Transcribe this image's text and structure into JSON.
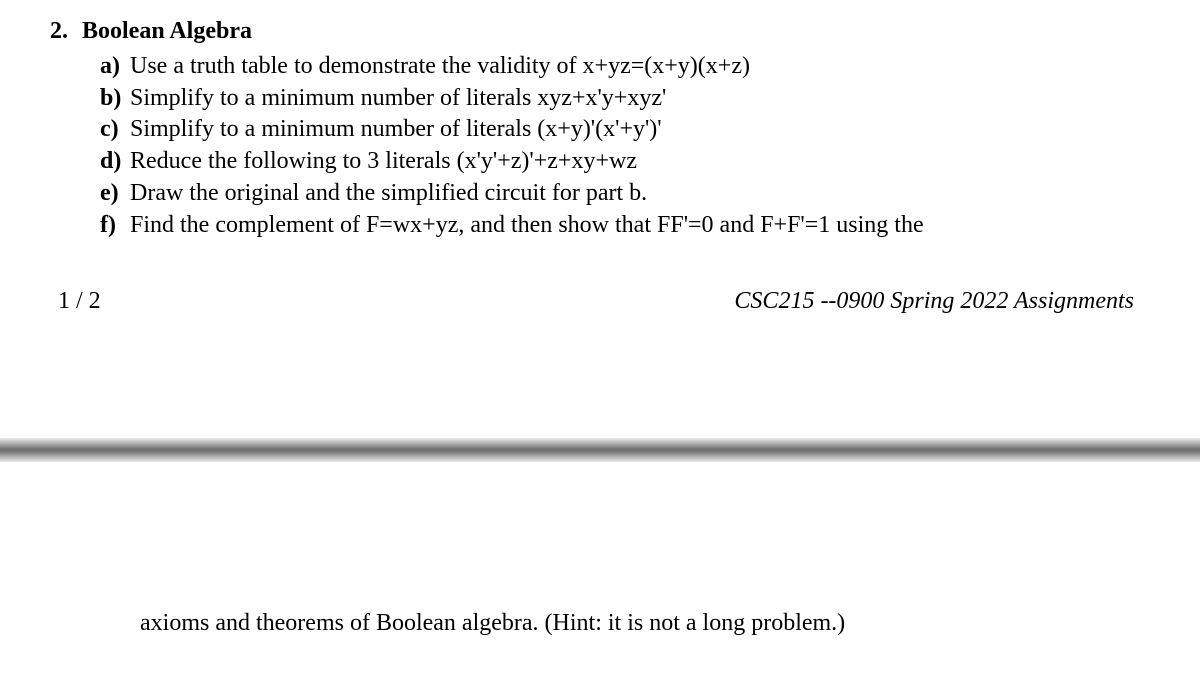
{
  "question": {
    "number": "2.",
    "title": "Boolean Algebra",
    "items": [
      {
        "marker": "a)",
        "text": "Use a truth table to demonstrate the validity of  x+yz=(x+y)(x+z)"
      },
      {
        "marker": "b)",
        "text": "Simplify to a minimum number of literals xyz+x'y+xyz'"
      },
      {
        "marker": "c)",
        "text": "Simplify to a minimum number of literals (x+y)'(x'+y')'"
      },
      {
        "marker": "d)",
        "text": "Reduce the following to 3 literals (x'y'+z)'+z+xy+wz"
      },
      {
        "marker": "e)",
        "text": "Draw the original and the simplified circuit for part b."
      },
      {
        "marker": "f)",
        "text": "Find the complement of F=wx+yz, and then show that FF'=0 and F+F'=1 using the"
      }
    ]
  },
  "footer": {
    "page_indicator": "1 / 2",
    "course": "CSC215 --0900 Spring 2022 Assignments"
  },
  "page2": {
    "continuation": "axioms and theorems of Boolean algebra. (Hint: it is not a long problem.)"
  }
}
